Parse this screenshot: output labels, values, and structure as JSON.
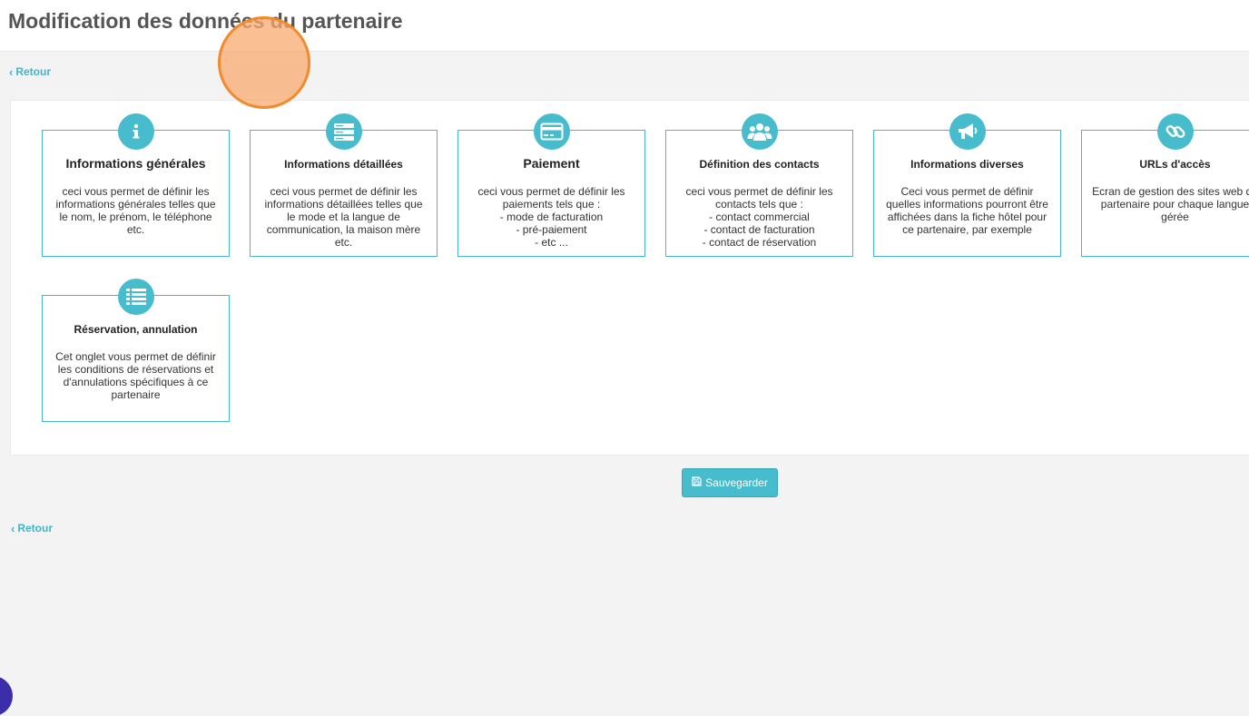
{
  "header": {
    "title": "Modification des données du partenaire"
  },
  "nav": {
    "back_label": "Retour",
    "back_label_bottom": "Retour"
  },
  "cards": [
    {
      "title": "Informations générales",
      "icon": "info-icon",
      "description": "ceci vous permet de définir les informations générales telles que le nom, le prénom, le téléphone etc."
    },
    {
      "title": "Informations détaillées",
      "icon": "server-icon",
      "description": "ceci vous permet de définir les informations détaillées telles que le mode et la langue de communication, la maison mère etc."
    },
    {
      "title": "Paiement",
      "icon": "credit-card-icon",
      "description": "ceci vous permet de définir les paiements tels que :\n- mode de facturation\n- pré-paiement\n- etc ..."
    },
    {
      "title": "Définition des contacts",
      "icon": "users-icon",
      "description": "ceci vous permet de définir les contacts tels que :\n- contact commercial\n- contact de facturation\n- contact de réservation"
    },
    {
      "title": "Informations diverses",
      "icon": "megaphone-icon",
      "description": "Ceci vous permet de définir quelles informations pourront être affichées dans la fiche hôtel pour ce partenaire, par exemple"
    },
    {
      "title": "URLs d'accès",
      "icon": "link-icon",
      "description": "Ecran de gestion des sites web du partenaire pour chaque langue gérée"
    },
    {
      "title": "Réservation, annulation",
      "icon": "list-icon",
      "description": "Cet onglet vous permet de définir les conditions de réservations et d'annulations spécifiques à ce partenaire"
    }
  ],
  "actions": {
    "save_label": "Sauvegarder",
    "save_icon": "floppy-disk-icon"
  },
  "colors": {
    "accent": "#46bccd",
    "card_border": "#44b8cc",
    "title_text": "#555555",
    "background": "#f3f3f3"
  }
}
